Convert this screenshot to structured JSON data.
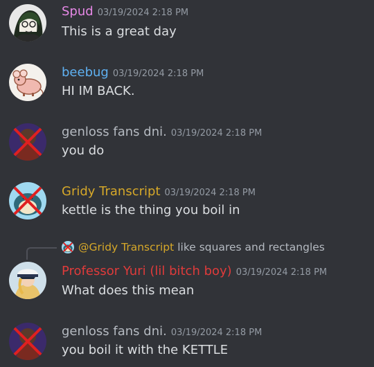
{
  "messages": [
    {
      "author": "Spud",
      "author_color": "#e688e6",
      "timestamp": "03/19/2024 2:18 PM",
      "text": "This is a great day",
      "avatar_icon": "green-haired-character-avatar"
    },
    {
      "author": "beebug",
      "author_color": "#5fb1f2",
      "timestamp": "03/19/2024 2:18 PM",
      "text": "HI IM BACK.",
      "avatar_icon": "mouse-avatar"
    },
    {
      "author": "genloss fans dni.",
      "author_color": "#b5bac1",
      "timestamp": "03/19/2024 2:18 PM",
      "text": "you do",
      "avatar_icon": "crossed-out-avatar"
    },
    {
      "author": "Gridy Transcript",
      "author_color": "#d6a829",
      "timestamp": "03/19/2024 2:18 PM",
      "text": "kettle is the thing you boil in",
      "avatar_icon": "crossed-out-snorlax-avatar"
    },
    {
      "reply_to": {
        "mention": "@Gridy Transcript",
        "text": "like squares and rectangles"
      },
      "author": "Professor Yuri (lil bitch boy)",
      "author_color": "#e03b3b",
      "timestamp": "03/19/2024 2:18 PM",
      "text": "What does this mean",
      "avatar_icon": "captain-hat-avatar"
    },
    {
      "author": "genloss fans dni.",
      "author_color": "#b5bac1",
      "timestamp": "03/19/2024 2:18 PM",
      "text": "you boil it with the KETTLE",
      "avatar_icon": "crossed-out-avatar"
    }
  ]
}
